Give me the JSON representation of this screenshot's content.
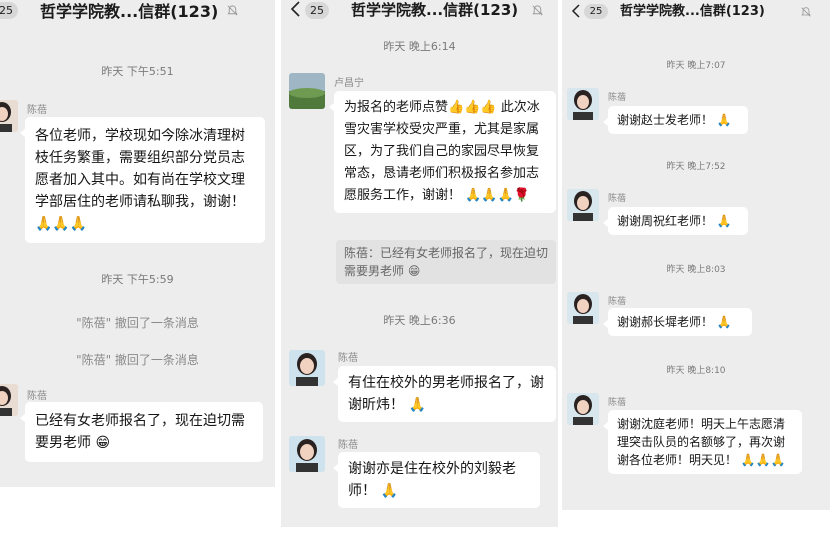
{
  "panels": [
    {
      "badge": "25",
      "title": "哲学学院教...信群(123)",
      "messages": {
        "t1": "昨天 下午5:51",
        "sender1": "陈蓓",
        "msg1": "各位老师，学校现如今除冰清理树枝任务繁重，需要组织部分党员志愿者加入其中。如有尚在学校文理学部居住的老师请私聊我，谢谢！",
        "msg1_emoji": "🙏🙏🙏",
        "t2": "昨天 下午5:59",
        "recall1": "\"陈蓓\" 撤回了一条消息",
        "recall2": "\"陈蓓\" 撤回了一条消息",
        "sender2": "陈蓓",
        "msg2": "已经有女老师报名了，现在迫切需要男老师",
        "msg2_emoji": "😁"
      }
    },
    {
      "badge": "25",
      "title": "哲学学院教...信群(123)",
      "messages": {
        "t1": "昨天 晚上6:14",
        "sender1": "卢昌宁",
        "msg1_prefix": "为报名的老师点赞",
        "msg1_prefix_emoji": "👍👍👍",
        "msg1": "此次冰雪灾害学校受灾严重，尤其是家属区，为了我们自己的家园尽早恢复常态，恳请老师们积极报名参加志愿服务工作，谢谢！",
        "msg1_emoji": "🙏🙏🙏🌹",
        "quote": "陈蓓：已经有女老师报名了，现在迫切需要男老师",
        "quote_emoji": "😁",
        "t2": "昨天 晚上6:36",
        "sender2": "陈蓓",
        "msg2": "有住在校外的男老师报名了，谢谢昕炜！",
        "msg2_emoji": "🙏",
        "sender3": "陈蓓",
        "msg3": "谢谢亦是住在校外的刘毅老师！",
        "msg3_emoji": "🙏"
      }
    },
    {
      "badge": "25",
      "title": "哲学学院教...信群(123)",
      "messages": {
        "t1": "昨天 晚上7:07",
        "sender1": "陈蓓",
        "msg1": "谢谢赵士发老师！",
        "msg1_emoji": "🙏",
        "t2": "昨天 晚上7:52",
        "sender2": "陈蓓",
        "msg2": "谢谢周祝红老师！",
        "msg2_emoji": "🙏",
        "t3": "昨天 晚上8:03",
        "sender3": "陈蓓",
        "msg3": "谢谢郝长墀老师！",
        "msg3_emoji": "🙏",
        "t4": "昨天 晚上8:10",
        "sender4": "陈蓓",
        "msg4": "谢谢沈庭老师！明天上午志愿清理突击队员的名额够了，再次谢谢各位老师！明天见！",
        "msg4_emoji": "🙏🙏🙏"
      }
    }
  ],
  "icons": {
    "back": "chevron-left-icon",
    "mute": "bell-muted-icon"
  }
}
